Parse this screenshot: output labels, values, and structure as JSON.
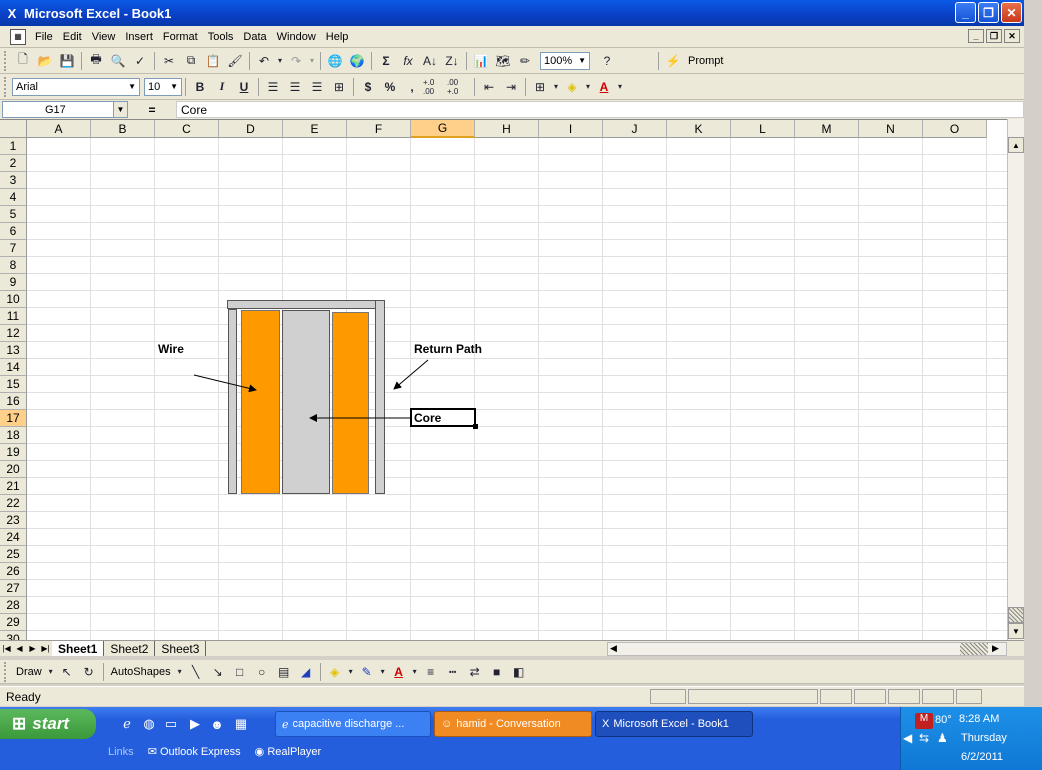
{
  "window": {
    "title": "Microsoft Excel - Book1"
  },
  "menu": {
    "items": [
      "File",
      "Edit",
      "View",
      "Insert",
      "Format",
      "Tools",
      "Data",
      "Window",
      "Help"
    ]
  },
  "toolbar": {
    "zoom": "100%",
    "prompt_label": "Prompt"
  },
  "format_toolbar": {
    "font": "Arial",
    "size": "10",
    "bold": "B",
    "italic": "I",
    "underline": "U",
    "currency": "$",
    "percent": "%",
    "comma": ",",
    "inc_decimal": "+.0 .00",
    "dec_decimal": ".00 +.0"
  },
  "formula_bar": {
    "name_box": "G17",
    "equals": "=",
    "value": "Core"
  },
  "grid": {
    "columns": [
      "A",
      "B",
      "C",
      "D",
      "E",
      "F",
      "G",
      "H",
      "I",
      "J",
      "K",
      "L",
      "M",
      "N",
      "O"
    ],
    "rows": [
      "1",
      "2",
      "3",
      "4",
      "5",
      "6",
      "7",
      "8",
      "9",
      "10",
      "11",
      "12",
      "13",
      "14",
      "15",
      "16",
      "17",
      "18",
      "19",
      "20",
      "21",
      "22",
      "23",
      "24",
      "25",
      "26",
      "27",
      "28",
      "29",
      "30"
    ],
    "selected_column": "G",
    "selected_row": "17"
  },
  "diagram": {
    "wire_label": "Wire",
    "return_label": "Return Path",
    "core_label": "Core",
    "colors": {
      "wire": "#ff9900",
      "core": "#d0d0d0",
      "frame": "#d0d0d0"
    }
  },
  "sheets": {
    "tabs": [
      "Sheet1",
      "Sheet2",
      "Sheet3"
    ],
    "active": "Sheet1"
  },
  "draw_toolbar": {
    "draw": "Draw",
    "autoshapes": "AutoShapes"
  },
  "status": {
    "text": "Ready"
  },
  "taskbar": {
    "start": "start",
    "tasks": [
      {
        "label": "capacitive discharge ...",
        "state": "normal"
      },
      {
        "label": "hamid - Conversation",
        "state": "flash"
      },
      {
        "label": "Microsoft Excel - Book1",
        "state": "active"
      }
    ],
    "links_label": "Links",
    "links": [
      "Outlook Express",
      "RealPlayer"
    ],
    "tray": {
      "temp": "80°",
      "time": "8:28 AM",
      "day": "Thursday",
      "date": "6/2/2011"
    }
  }
}
